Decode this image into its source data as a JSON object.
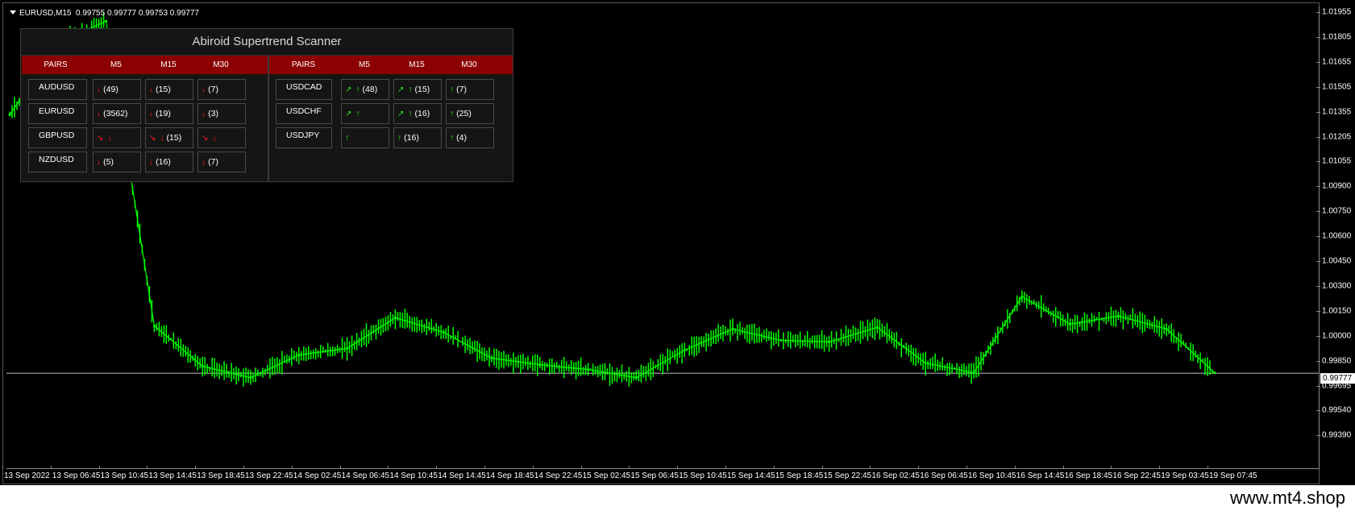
{
  "chart": {
    "symbol": "EURUSD,M15",
    "ohlc": "0.99755 0.99777 0.99753 0.99777",
    "current_price": "0.99777",
    "price_labels": [
      "1.01955",
      "1.01805",
      "1.01655",
      "1.01505",
      "1.01355",
      "1.01205",
      "1.01055",
      "1.00900",
      "1.00750",
      "1.00600",
      "1.00450",
      "1.00300",
      "1.00150",
      "1.00000",
      "0.99850",
      "0.99695",
      "0.99540",
      "0.99390"
    ],
    "time_labels": [
      "13 Sep 2022",
      "13 Sep 06:45",
      "13 Sep 10:45",
      "13 Sep 14:45",
      "13 Sep 18:45",
      "13 Sep 22:45",
      "14 Sep 02:45",
      "14 Sep 06:45",
      "14 Sep 10:45",
      "14 Sep 14:45",
      "14 Sep 18:45",
      "14 Sep 22:45",
      "15 Sep 02:45",
      "15 Sep 06:45",
      "15 Sep 10:45",
      "15 Sep 14:45",
      "15 Sep 18:45",
      "15 Sep 22:45",
      "16 Sep 02:45",
      "16 Sep 06:45",
      "16 Sep 10:45",
      "16 Sep 14:45",
      "16 Sep 18:45",
      "16 Sep 22:45",
      "19 Sep 03:45",
      "19 Sep 07:45"
    ],
    "candle_color": "#00ff00",
    "price_line_color": "#c0c0c0"
  },
  "chart_data": {
    "type": "line",
    "title": "",
    "xlabel": "",
    "ylabel": "",
    "ylim": [
      0.9939,
      1.02
    ],
    "x": [
      "13 Sep 2022",
      "13 Sep 06:45",
      "13 Sep 10:45",
      "13 Sep 14:45",
      "13 Sep 18:45",
      "13 Sep 22:45",
      "14 Sep 02:45",
      "14 Sep 06:45",
      "14 Sep 10:45",
      "14 Sep 14:45",
      "14 Sep 18:45",
      "14 Sep 22:45",
      "15 Sep 02:45",
      "15 Sep 06:45",
      "15 Sep 10:45",
      "15 Sep 14:45",
      "15 Sep 18:45",
      "15 Sep 22:45",
      "16 Sep 02:45",
      "16 Sep 06:45",
      "16 Sep 10:45",
      "16 Sep 14:45",
      "16 Sep 18:45",
      "16 Sep 22:45",
      "19 Sep 03:45",
      "19 Sep 07:45"
    ],
    "series": [
      {
        "values": [
          1.0137,
          1.0181,
          1.0195,
          1.0007,
          0.9982,
          0.9975,
          0.9989,
          0.9993,
          1.0012,
          1.0003,
          0.9987,
          0.9983,
          0.998,
          0.9975,
          0.9992,
          1.0005,
          0.9998,
          0.9997,
          1.0006,
          0.9984,
          0.9978,
          1.0025,
          1.0008,
          1.0013,
          1.0005,
          0.9978
        ]
      }
    ]
  },
  "scanner": {
    "title": "Abiroid Supertrend Scanner",
    "left": {
      "headers": [
        "PAIRS",
        "M5",
        "M15",
        "M30"
      ],
      "rows": [
        {
          "pair": "AUDUSD",
          "cells": [
            {
              "a": "↓",
              "c": "dn",
              "t": " (49)"
            },
            {
              "a": "↓",
              "c": "dn",
              "t": " (15)"
            },
            {
              "a": "↓",
              "c": "dn",
              "t": " (7)"
            }
          ]
        },
        {
          "pair": "EURUSD",
          "cells": [
            {
              "a": "↓",
              "c": "dn",
              "t": " (3562)"
            },
            {
              "a": "↓",
              "c": "dn",
              "t": " (19)"
            },
            {
              "a": "↓",
              "c": "dn",
              "t": " (3)"
            }
          ]
        },
        {
          "pair": "GBPUSD",
          "cells": [
            {
              "d": "↘",
              "dc": "dd",
              "a": "↓",
              "c": "dn",
              "t": ""
            },
            {
              "d": "↘",
              "dc": "dd",
              "a": "↓",
              "c": "dn",
              "t": " (15)"
            },
            {
              "d": "↘",
              "dc": "dd",
              "a": "↓",
              "c": "dn",
              "t": ""
            }
          ]
        },
        {
          "pair": "NZDUSD",
          "cells": [
            {
              "a": "↓",
              "c": "dn",
              "t": " (5)"
            },
            {
              "a": "↓",
              "c": "dn",
              "t": " (16)"
            },
            {
              "a": "↓",
              "c": "dn",
              "t": " (7)"
            }
          ]
        }
      ]
    },
    "right": {
      "headers": [
        "PAIRS",
        "M5",
        "M15",
        "M30"
      ],
      "rows": [
        {
          "pair": "USDCAD",
          "cells": [
            {
              "d": "↗",
              "dc": "du",
              "a": "↑",
              "c": "up",
              "t": " (48)"
            },
            {
              "d": "↗",
              "dc": "du",
              "a": "↑",
              "c": "up",
              "t": " (15)"
            },
            {
              "a": "↑",
              "c": "up",
              "t": " (7)"
            }
          ]
        },
        {
          "pair": "USDCHF",
          "cells": [
            {
              "d": "↗",
              "dc": "du",
              "a": "↑",
              "c": "up",
              "t": ""
            },
            {
              "d": "↗",
              "dc": "du",
              "a": "↑",
              "c": "up",
              "t": " (16)"
            },
            {
              "a": "↑",
              "c": "up",
              "t": " (25)"
            }
          ]
        },
        {
          "pair": "USDJPY",
          "cells": [
            {
              "a": "↑",
              "c": "up",
              "t": ""
            },
            {
              "a": "↑",
              "c": "up",
              "t": " (16)"
            },
            {
              "a": "↑",
              "c": "up",
              "t": " (4)"
            }
          ]
        }
      ]
    }
  },
  "watermark": "www.mt4.shop"
}
